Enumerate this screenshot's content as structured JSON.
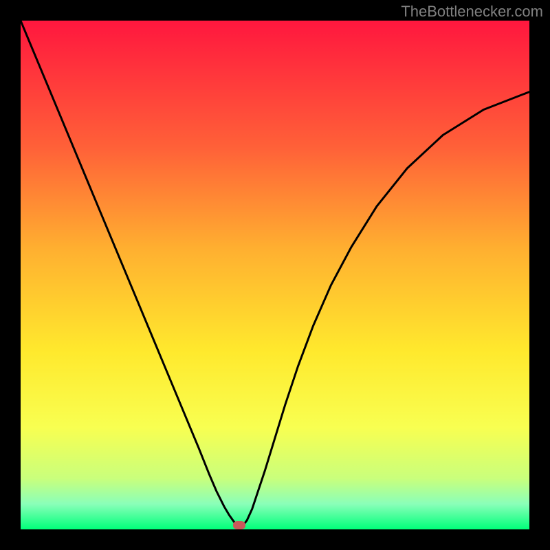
{
  "watermark": "TheBottlenecker.com",
  "marker": {
    "x_frac": 0.43,
    "y_frac": 0.992,
    "color": "#c85a5a"
  },
  "chart_data": {
    "type": "line",
    "title": "",
    "xlabel": "",
    "ylabel": "",
    "xlim": [
      0,
      1
    ],
    "ylim": [
      0,
      1
    ],
    "x": [
      0.0,
      0.025,
      0.05,
      0.075,
      0.1,
      0.125,
      0.15,
      0.175,
      0.2,
      0.225,
      0.25,
      0.275,
      0.3,
      0.325,
      0.35,
      0.37,
      0.385,
      0.4,
      0.41,
      0.42,
      0.428,
      0.435,
      0.445,
      0.455,
      0.465,
      0.48,
      0.5,
      0.52,
      0.545,
      0.575,
      0.61,
      0.65,
      0.7,
      0.76,
      0.83,
      0.91,
      1.0
    ],
    "y": [
      1.0,
      0.94,
      0.88,
      0.82,
      0.76,
      0.7,
      0.64,
      0.58,
      0.52,
      0.46,
      0.4,
      0.34,
      0.28,
      0.22,
      0.16,
      0.11,
      0.075,
      0.045,
      0.028,
      0.014,
      0.005,
      0.005,
      0.018,
      0.04,
      0.07,
      0.115,
      0.18,
      0.245,
      0.32,
      0.4,
      0.48,
      0.555,
      0.635,
      0.71,
      0.775,
      0.825,
      0.86
    ],
    "gradient_stops": [
      {
        "pos": 0.0,
        "color": "#ff173e"
      },
      {
        "pos": 0.25,
        "color": "#ff6138"
      },
      {
        "pos": 0.45,
        "color": "#ffb030"
      },
      {
        "pos": 0.65,
        "color": "#ffe92d"
      },
      {
        "pos": 0.8,
        "color": "#f8ff51"
      },
      {
        "pos": 0.9,
        "color": "#c9ff7c"
      },
      {
        "pos": 0.95,
        "color": "#8affb9"
      },
      {
        "pos": 1.0,
        "color": "#00ff7a"
      }
    ],
    "marker_point": {
      "x": 0.43,
      "y": 0.008
    }
  }
}
